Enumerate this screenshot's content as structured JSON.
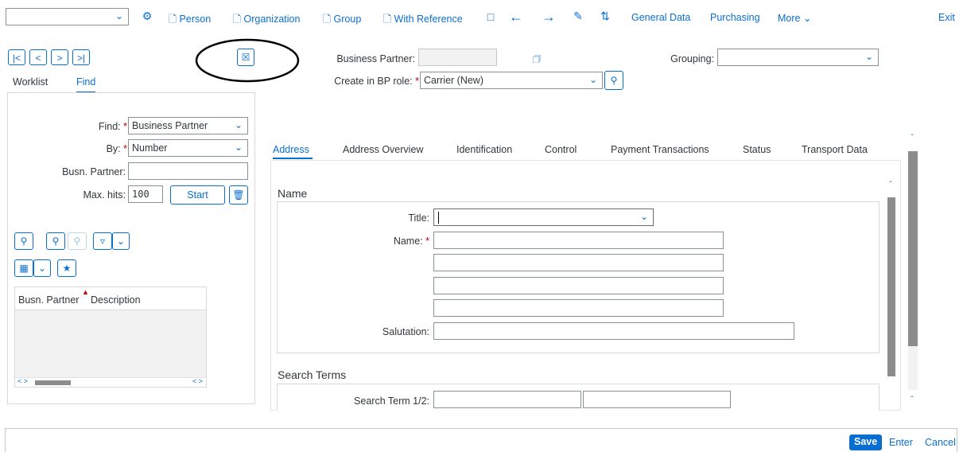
{
  "toolbar": {
    "dropdown_value": "",
    "person": "Person",
    "organization": "Organization",
    "group": "Group",
    "with_reference": "With Reference",
    "general_data": "General Data",
    "purchasing": "Purchasing",
    "more": "More",
    "exit": "Exit"
  },
  "left": {
    "tab_worklist": "Worklist",
    "tab_find": "Find",
    "find_label": "Find:",
    "find_value": "Business Partner",
    "by_label": "By:",
    "by_value": "Number",
    "busn_partner_label": "Busn. Partner:",
    "busn_partner_value": "",
    "max_hits_label": "Max. hits:",
    "max_hits_value": "100",
    "start": "Start",
    "table_columns": [
      "Busn. Partner",
      "Description"
    ]
  },
  "header": {
    "bp_label": "Business Partner:",
    "bp_value": "",
    "role_label": "Create in BP role:",
    "role_value": "Carrier (New)",
    "grouping_label": "Grouping:",
    "grouping_value": ""
  },
  "tabs": [
    "Address",
    "Address Overview",
    "Identification",
    "Control",
    "Payment Transactions",
    "Status",
    "Transport Data"
  ],
  "name_section": {
    "title": "Name",
    "title_label": "Title:",
    "title_value": "",
    "name_label": "Name:",
    "salutation_label": "Salutation:"
  },
  "search_section": {
    "title": "Search Terms",
    "search_term_label": "Search Term 1/2:"
  },
  "footer": {
    "save": "Save",
    "enter": "Enter",
    "cancel": "Cancel"
  },
  "colors": {
    "accent": "#0a6ed1",
    "required": "#bb0000",
    "annotation": "#000000"
  }
}
